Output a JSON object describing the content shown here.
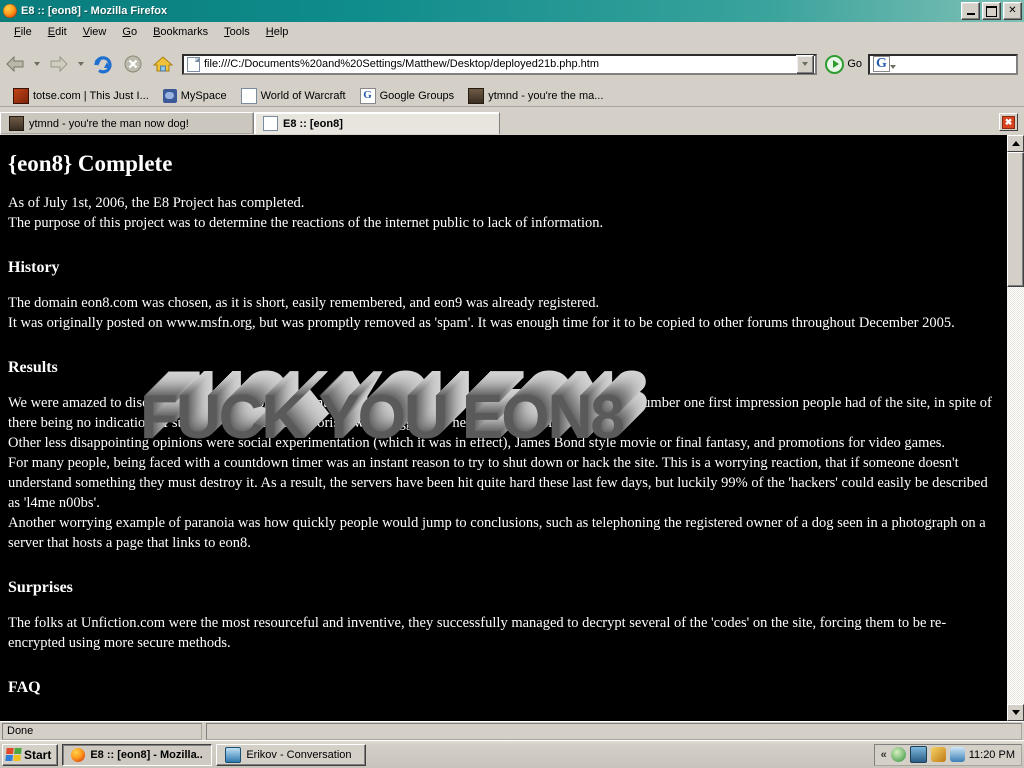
{
  "window": {
    "title": "E8 :: [eon8] - Mozilla Firefox",
    "app_icon": "firefox-icon",
    "minimize_label": "_",
    "maximize_label": "❐",
    "close_label": "✕"
  },
  "menubar": {
    "items": [
      {
        "label": "File",
        "accel": "F"
      },
      {
        "label": "Edit",
        "accel": "E"
      },
      {
        "label": "View",
        "accel": "V"
      },
      {
        "label": "Go",
        "accel": "G"
      },
      {
        "label": "Bookmarks",
        "accel": "B"
      },
      {
        "label": "Tools",
        "accel": "T"
      },
      {
        "label": "Help",
        "accel": "H"
      }
    ]
  },
  "toolbar": {
    "back_icon": "back-arrow-icon",
    "forward_icon": "forward-arrow-icon",
    "reload_icon": "reload-icon",
    "stop_icon": "stop-icon",
    "home_icon": "home-icon",
    "url": "file:///C:/Documents%20and%20Settings/Matthew/Desktop/deployed21b.php.htm",
    "url_placeholder": "Enter address",
    "go_label": "Go",
    "search_value": "",
    "search_placeholder": "",
    "search_engine_icon": "google-icon",
    "search_engine_letter": "G"
  },
  "bookmarks": {
    "items": [
      {
        "label": "totse.com | This Just I...",
        "icon": "totse-favicon"
      },
      {
        "label": "MySpace",
        "icon": "myspace-favicon"
      },
      {
        "label": "World of Warcraft",
        "icon": "generic-page-favicon"
      },
      {
        "label": "Google Groups",
        "icon": "google-favicon"
      },
      {
        "label": "ytmnd - you're the ma...",
        "icon": "ytmnd-favicon"
      }
    ]
  },
  "tabs": {
    "items": [
      {
        "label": "ytmnd - you're the man now dog!",
        "icon": "ytmnd-favicon",
        "active": false
      },
      {
        "label": "E8 :: [eon8]",
        "icon": "generic-page-favicon",
        "active": true
      }
    ],
    "close_label": "✖"
  },
  "page": {
    "heading": "{eon8} Complete",
    "intro": [
      "As of July 1st, 2006, the E8 Project has completed.",
      "The purpose of this project was to determine the reactions of the internet public to lack of information."
    ],
    "sections": [
      {
        "title": "History",
        "paragraphs": [
          "The domain eon8.com was chosen, as it is short, easily remembered, and eon9 was already registered.",
          "It was originally posted on www.msfn.org, but was promptly removed as 'spam'. It was enough time for it to be copied to other forums throughout December 2005."
        ]
      },
      {
        "title": "Results",
        "paragraphs": [
          "We were amazed to discover that the reaction of the internet public to the unknown was fear. \"Evil\" was the number one first impression people had of the site, in spite of there being no indication of such. Even threats of terrorism were suggested \"here\". Nothing else.",
          "Other less disappointing opinions were social experimentation (which it was in effect), James Bond style movie or final fantasy, and promotions for video games.",
          "For many people, being faced with a countdown timer was an instant reason to try to shut down or hack the site. This is a worrying reaction, that if someone doesn't understand something they must destroy it. As a result, the servers have been hit quite hard these last few days, but luckily 99% of the 'hackers' could easily be described as 'l4me n00bs'.",
          "Another worrying example of paranoia was how quickly people would jump to conclusions, such as telephoning the registered owner of a dog seen in a photograph on a server that hosts a page that links to eon8."
        ]
      },
      {
        "title": "Surprises",
        "paragraphs": [
          "The folks at Unfiction.com were the most resourceful and inventive, they successfully managed to decrypt several of the 'codes' on the site, forcing them to be re-encrypted using more secure methods."
        ]
      },
      {
        "title": "FAQ",
        "paragraphs": []
      }
    ],
    "overlay_text": "FUCK YOU EON8"
  },
  "statusbar": {
    "status": "Done",
    "secondary": ""
  },
  "taskbar": {
    "start_label": "Start",
    "buttons": [
      {
        "label": "E8 :: [eon8] - Mozilla...",
        "icon": "firefox-icon",
        "active": true
      },
      {
        "label": "Erikov - Conversation",
        "icon": "messenger-icon",
        "active": false
      }
    ],
    "tray": {
      "expand_label": "«",
      "icons": [
        "antivirus-icon",
        "display-icon",
        "link-icon",
        "messenger-icon"
      ],
      "clock": "11:20 PM"
    }
  },
  "scrollbar": {
    "up_label": "▲",
    "down_label": "▼"
  },
  "colors": {
    "titlebar": "#0f8c8c",
    "chrome": "#d4d0c8",
    "page_bg": "#000000",
    "page_fg": "#ffffff"
  }
}
